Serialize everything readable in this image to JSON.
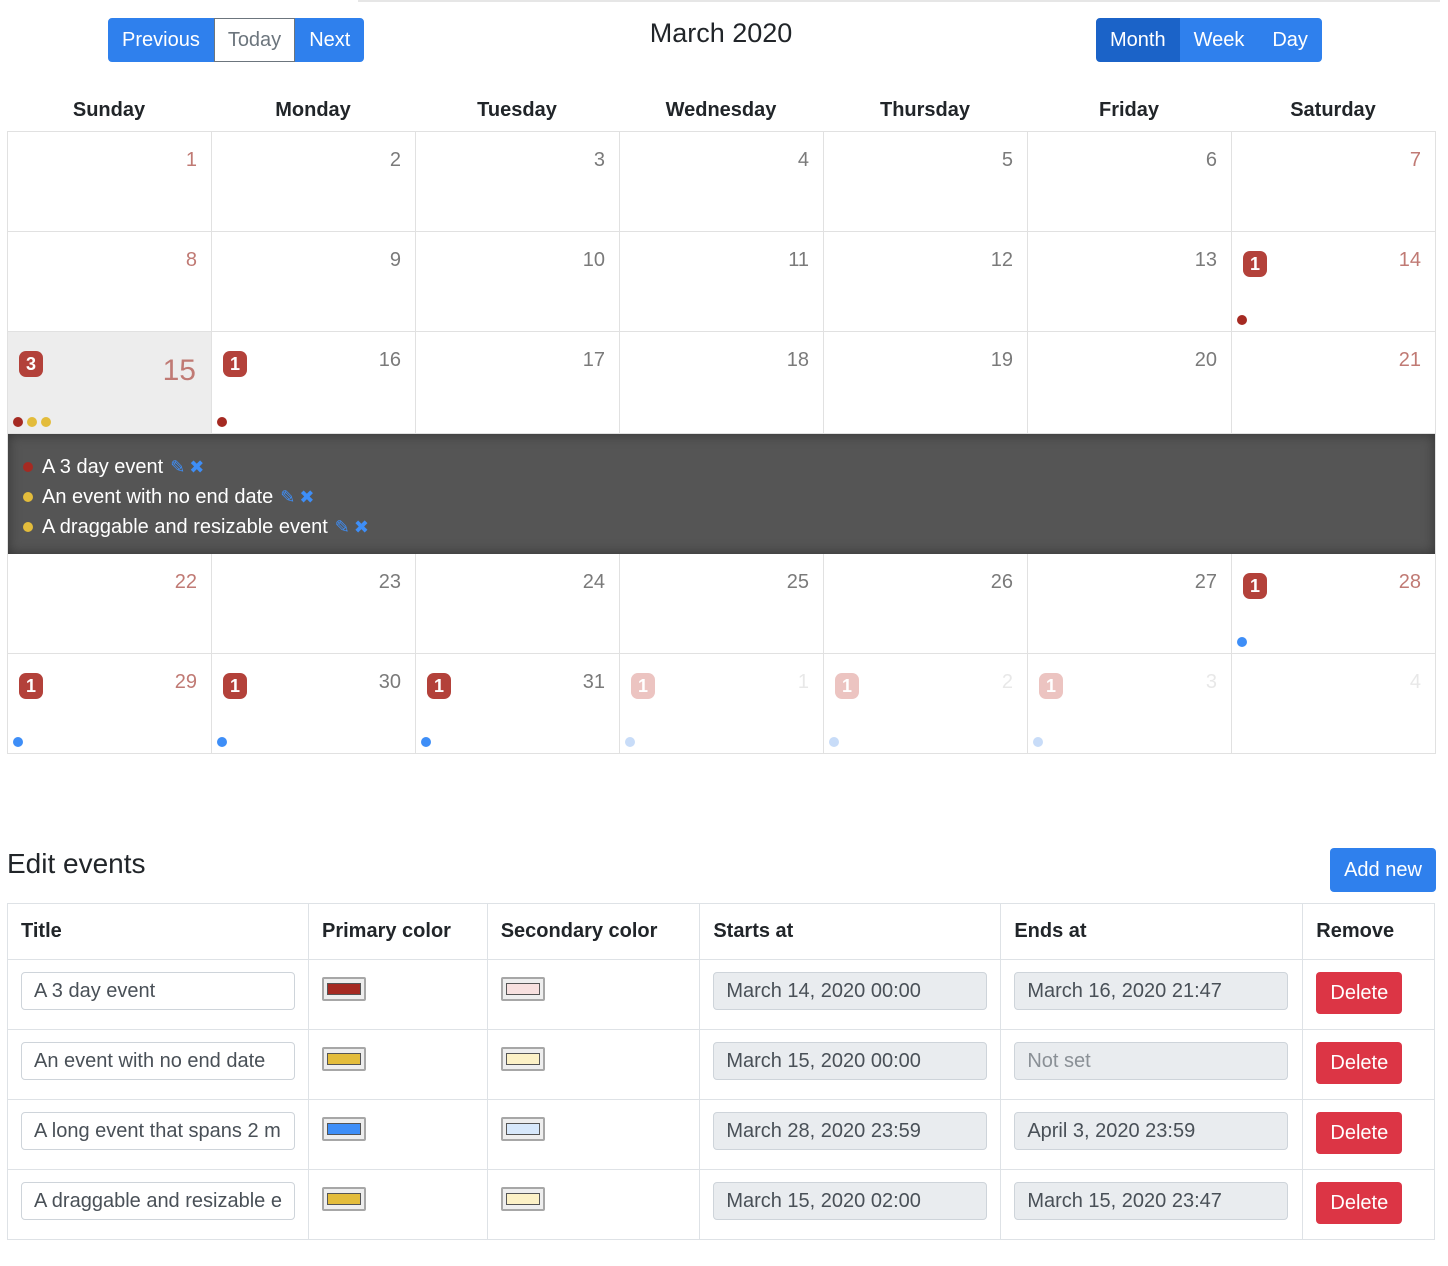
{
  "toolbar": {
    "previous": "Previous",
    "today": "Today",
    "next": "Next",
    "title": "March 2020",
    "views": [
      "Month",
      "Week",
      "Day"
    ],
    "active_view": "Month"
  },
  "colors": {
    "red": "#a52a22",
    "yellow": "#e3bc3b",
    "blue": "#3e8ef7",
    "light_blue": "#c8dcf8",
    "accent": "#2f80ed",
    "danger": "#dc3545"
  },
  "calendar": {
    "weekdays": [
      "Sunday",
      "Monday",
      "Tuesday",
      "Wednesday",
      "Thursday",
      "Friday",
      "Saturday"
    ],
    "weeks": [
      [
        {
          "day": "1"
        },
        {
          "day": "2"
        },
        {
          "day": "3"
        },
        {
          "day": "4"
        },
        {
          "day": "5"
        },
        {
          "day": "6"
        },
        {
          "day": "7"
        }
      ],
      [
        {
          "day": "8"
        },
        {
          "day": "9"
        },
        {
          "day": "10"
        },
        {
          "day": "11"
        },
        {
          "day": "12"
        },
        {
          "day": "13"
        },
        {
          "day": "14",
          "badge": "1",
          "dots": [
            "#a52a22"
          ]
        }
      ],
      [
        {
          "day": "15",
          "badge": "3",
          "dots": [
            "#a52a22",
            "#e3bc3b",
            "#e3bc3b"
          ],
          "today": true
        },
        {
          "day": "16",
          "badge": "1",
          "dots": [
            "#a52a22"
          ]
        },
        {
          "day": "17"
        },
        {
          "day": "18"
        },
        {
          "day": "19"
        },
        {
          "day": "20"
        },
        {
          "day": "21"
        }
      ],
      [
        {
          "day": "22"
        },
        {
          "day": "23"
        },
        {
          "day": "24"
        },
        {
          "day": "25"
        },
        {
          "day": "26"
        },
        {
          "day": "27"
        },
        {
          "day": "28",
          "badge": "1",
          "dots": [
            "#3e8ef7"
          ]
        }
      ],
      [
        {
          "day": "29",
          "badge": "1",
          "dots": [
            "#3e8ef7"
          ]
        },
        {
          "day": "30",
          "badge": "1",
          "dots": [
            "#3e8ef7"
          ]
        },
        {
          "day": "31",
          "badge": "1",
          "dots": [
            "#3e8ef7"
          ]
        },
        {
          "day": "1",
          "badge": "1",
          "dots": [
            "#c8dcf8"
          ],
          "out": true
        },
        {
          "day": "2",
          "badge": "1",
          "dots": [
            "#c8dcf8"
          ],
          "out": true
        },
        {
          "day": "3",
          "badge": "1",
          "dots": [
            "#c8dcf8"
          ],
          "out": true
        },
        {
          "day": "4",
          "out": true
        }
      ]
    ],
    "open_day_events": [
      {
        "title": "A 3 day event",
        "color": "#a52a22"
      },
      {
        "title": "An event with no end date",
        "color": "#e3bc3b"
      },
      {
        "title": "A draggable and resizable event",
        "color": "#e3bc3b"
      }
    ],
    "edit_icon": "pencil-icon",
    "delete_icon": "times-icon"
  },
  "edit": {
    "heading": "Edit events",
    "add_new": "Add new",
    "columns": [
      "Title",
      "Primary color",
      "Secondary color",
      "Starts at",
      "Ends at",
      "Remove"
    ],
    "delete_label": "Delete",
    "rows": [
      {
        "title": "A 3 day event",
        "primary": "#a52a22",
        "secondary": "#f7e0df",
        "starts": "March 14, 2020 00:00",
        "ends": "March 16, 2020 21:47",
        "ends_placeholder": false
      },
      {
        "title": "An event with no end date",
        "primary": "#e3bc3b",
        "secondary": "#fcf1c6",
        "starts": "March 15, 2020 00:00",
        "ends": "Not set",
        "ends_placeholder": true
      },
      {
        "title": "A long event that spans 2 m",
        "primary": "#3e8ef7",
        "secondary": "#d7e8fb",
        "starts": "March 28, 2020 23:59",
        "ends": "April 3, 2020 23:59",
        "ends_placeholder": false
      },
      {
        "title": "A draggable and resizable e",
        "primary": "#e3bc3b",
        "secondary": "#fcf1c6",
        "starts": "March 15, 2020 02:00",
        "ends": "March 15, 2020 23:47",
        "ends_placeholder": false
      }
    ]
  }
}
